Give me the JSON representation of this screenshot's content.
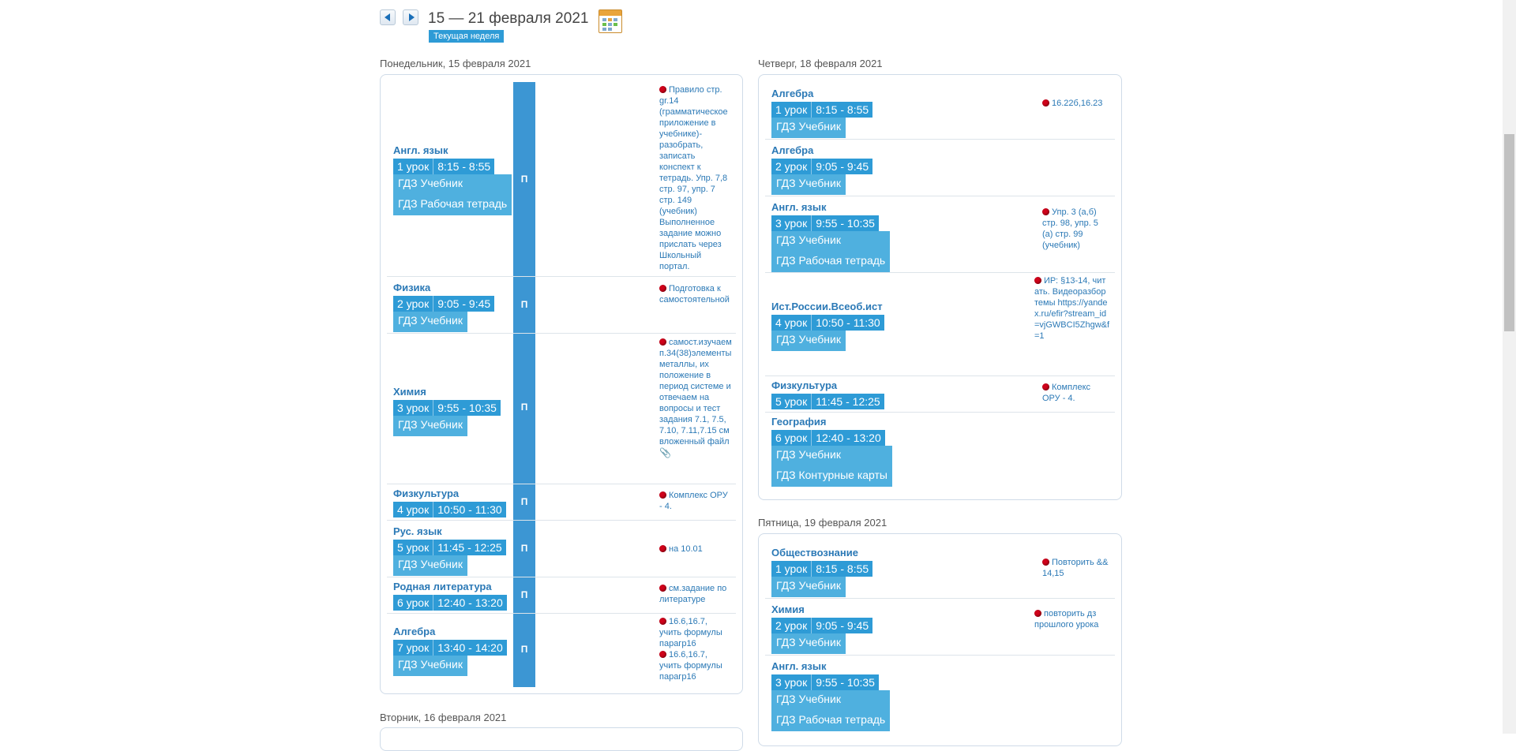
{
  "week": {
    "title": "15 — 21 февраля 2021",
    "current_label": "Текущая неделя"
  },
  "days": {
    "mon": {
      "label": "Понедельник, 15 февраля 2021",
      "lessons": [
        {
          "subject": "Англ. язык",
          "num": "1 урок",
          "time": "8:15 - 8:55",
          "gdz": [
            "ГДЗ Учебник",
            "ГДЗ Рабочая тетрадь"
          ],
          "mark": "П",
          "hw": "Правило стр. gr.14 (грамматическое приложение в учебнике)- разобрать, записать конспект к тетрадь. Упр. 7,8 стр. 97, упр. 7 стр. 149 (учебник) Выполненное задание можно прислать через Школьный портал."
        },
        {
          "subject": "Физика",
          "num": "2 урок",
          "time": "9:05 - 9:45",
          "gdz": [
            "ГДЗ Учебник"
          ],
          "mark": "П",
          "hw": "Подготовка к самостоятельной"
        },
        {
          "subject": "Химия",
          "num": "3 урок",
          "time": "9:55 - 10:35",
          "gdz": [
            "ГДЗ Учебник"
          ],
          "mark": "П",
          "hw": "самост.изучаем п.34(38)элементы металлы, их положение в период системе и отвечаем на вопросы и тест задания 7.1, 7.5, 7.10, 7.11,7.15 см вложенный файл"
        },
        {
          "subject": "Физкультура",
          "num": "4 урок",
          "time": "10:50 - 11:30",
          "gdz": [],
          "mark": "П",
          "hw": "Комплекс ОРУ - 4."
        },
        {
          "subject": "Рус. язык",
          "num": "5 урок",
          "time": "11:45 - 12:25",
          "gdz": [
            "ГДЗ Учебник"
          ],
          "mark": "П",
          "hw": "на 10.01"
        },
        {
          "subject": "Родная литература",
          "num": "6 урок",
          "time": "12:40 - 13:20",
          "gdz": [],
          "mark": "П",
          "hw": "см.задание по литературе"
        },
        {
          "subject": "Алгебра",
          "num": "7 урок",
          "time": "13:40 - 14:20",
          "gdz": [
            "ГДЗ Учебник"
          ],
          "mark": "П",
          "hw": "16.6,16.7, учить формулы парагр16",
          "hw2": "16.6,16.7, учить формулы парагр16"
        }
      ]
    },
    "tue": {
      "label": "Вторник, 16 февраля 2021"
    },
    "thu": {
      "label": "Четверг, 18 февраля 2021",
      "lessons": [
        {
          "subject": "Алгебра",
          "num": "1 урок",
          "time": "8:15 - 8:55",
          "gdz": [
            "ГДЗ Учебник"
          ],
          "hw": "16.22б,16.23"
        },
        {
          "subject": "Алгебра",
          "num": "2 урок",
          "time": "9:05 - 9:45",
          "gdz": [
            "ГДЗ Учебник"
          ],
          "hw": ""
        },
        {
          "subject": "Англ. язык",
          "num": "3 урок",
          "time": "9:55 - 10:35",
          "gdz": [
            "ГДЗ Учебник",
            "ГДЗ Рабочая тетрадь"
          ],
          "hw": "Упр. 3 (а,б) стр. 98, упр. 5 (а) стр. 99 (учебник)"
        },
        {
          "subject": "Ист.России.Всеоб.ист",
          "num": "4 урок",
          "time": "10:50 - 11:30",
          "gdz": [
            "ГДЗ Учебник"
          ],
          "hw": "ИР: §13-14, читать. Видеоразбор темы https://yandex.ru/efir?stream_id=vjGWBCI5Zhgw&f=1"
        },
        {
          "subject": "Физкультура",
          "num": "5 урок",
          "time": "11:45 - 12:25",
          "gdz": [],
          "hw": "Комплекс ОРУ - 4."
        },
        {
          "subject": "География",
          "num": "6 урок",
          "time": "12:40 - 13:20",
          "gdz": [
            "ГДЗ Учебник",
            "ГДЗ Контурные карты"
          ],
          "hw": ""
        }
      ]
    },
    "fri": {
      "label": "Пятница, 19 февраля 2021",
      "lessons": [
        {
          "subject": "Обществознание",
          "num": "1 урок",
          "time": "8:15 - 8:55",
          "gdz": [
            "ГДЗ Учебник"
          ],
          "hw": "Повторить && 14,15"
        },
        {
          "subject": "Химия",
          "num": "2 урок",
          "time": "9:05 - 9:45",
          "gdz": [
            "ГДЗ Учебник"
          ],
          "hw": "повторить дз прошлого урока"
        },
        {
          "subject": "Англ. язык",
          "num": "3 урок",
          "time": "9:55 - 10:35",
          "gdz": [
            "ГДЗ Учебник",
            "ГДЗ Рабочая тетрадь"
          ],
          "hw": ""
        }
      ]
    }
  },
  "icons": {
    "attachment": "paperclip-icon",
    "calendar": "calendar-icon"
  },
  "colors": {
    "accent": "#2e9bd6",
    "link": "#2b79b6",
    "hw_dot": "#d0021b"
  }
}
